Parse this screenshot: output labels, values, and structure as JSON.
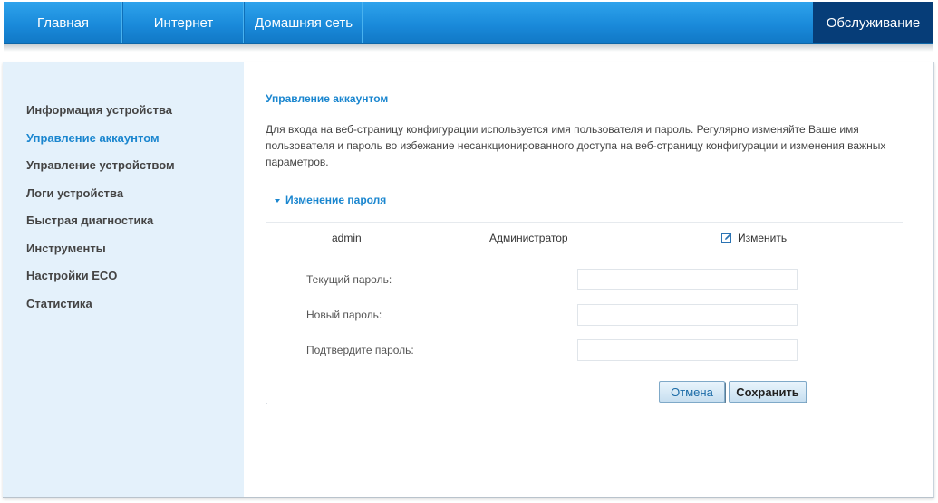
{
  "topnav": {
    "tabs": [
      {
        "label": "Главная"
      },
      {
        "label": "Интернет"
      },
      {
        "label": "Домашняя сеть"
      }
    ],
    "active_tab": {
      "label": "Обслуживание"
    }
  },
  "sidebar": {
    "items": [
      {
        "label": "Информация устройства",
        "active": false
      },
      {
        "label": "Управление аккаунтом",
        "active": true
      },
      {
        "label": "Управление устройством",
        "active": false
      },
      {
        "label": "Логи устройства",
        "active": false
      },
      {
        "label": "Быстрая диагностика",
        "active": false
      },
      {
        "label": "Инструменты",
        "active": false
      },
      {
        "label": "Настройки ECO",
        "active": false
      },
      {
        "label": "Статистика",
        "active": false
      }
    ]
  },
  "main": {
    "title": "Управление аккаунтом",
    "description": "Для входа на веб-страницу конфигурации используется имя пользователя и пароль. Регулярно изменяйте Ваше имя пользователя и пароль во избежание несанкционированного доступа на веб-страницу конфигурации и изменения важных параметров.",
    "section": {
      "title": "Изменение пароля",
      "icon": "chevron-down-icon"
    },
    "account": {
      "username": "admin",
      "role": "Администратор",
      "edit_label": "Изменить",
      "edit_icon": "edit-icon"
    },
    "form": {
      "current_password_label": "Текущий пароль:",
      "current_password_value": "",
      "new_password_label": "Новый пароль:",
      "new_password_value": "",
      "confirm_password_label": "Подтвердите пароль:",
      "confirm_password_value": ""
    },
    "buttons": {
      "cancel_label": "Отмена",
      "save_label": "Сохранить"
    }
  },
  "colors": {
    "nav_blue": "#1a8ada",
    "nav_active": "#063d78",
    "accent": "#1a86cf",
    "sidebar_bg": "#e4f1fb"
  }
}
